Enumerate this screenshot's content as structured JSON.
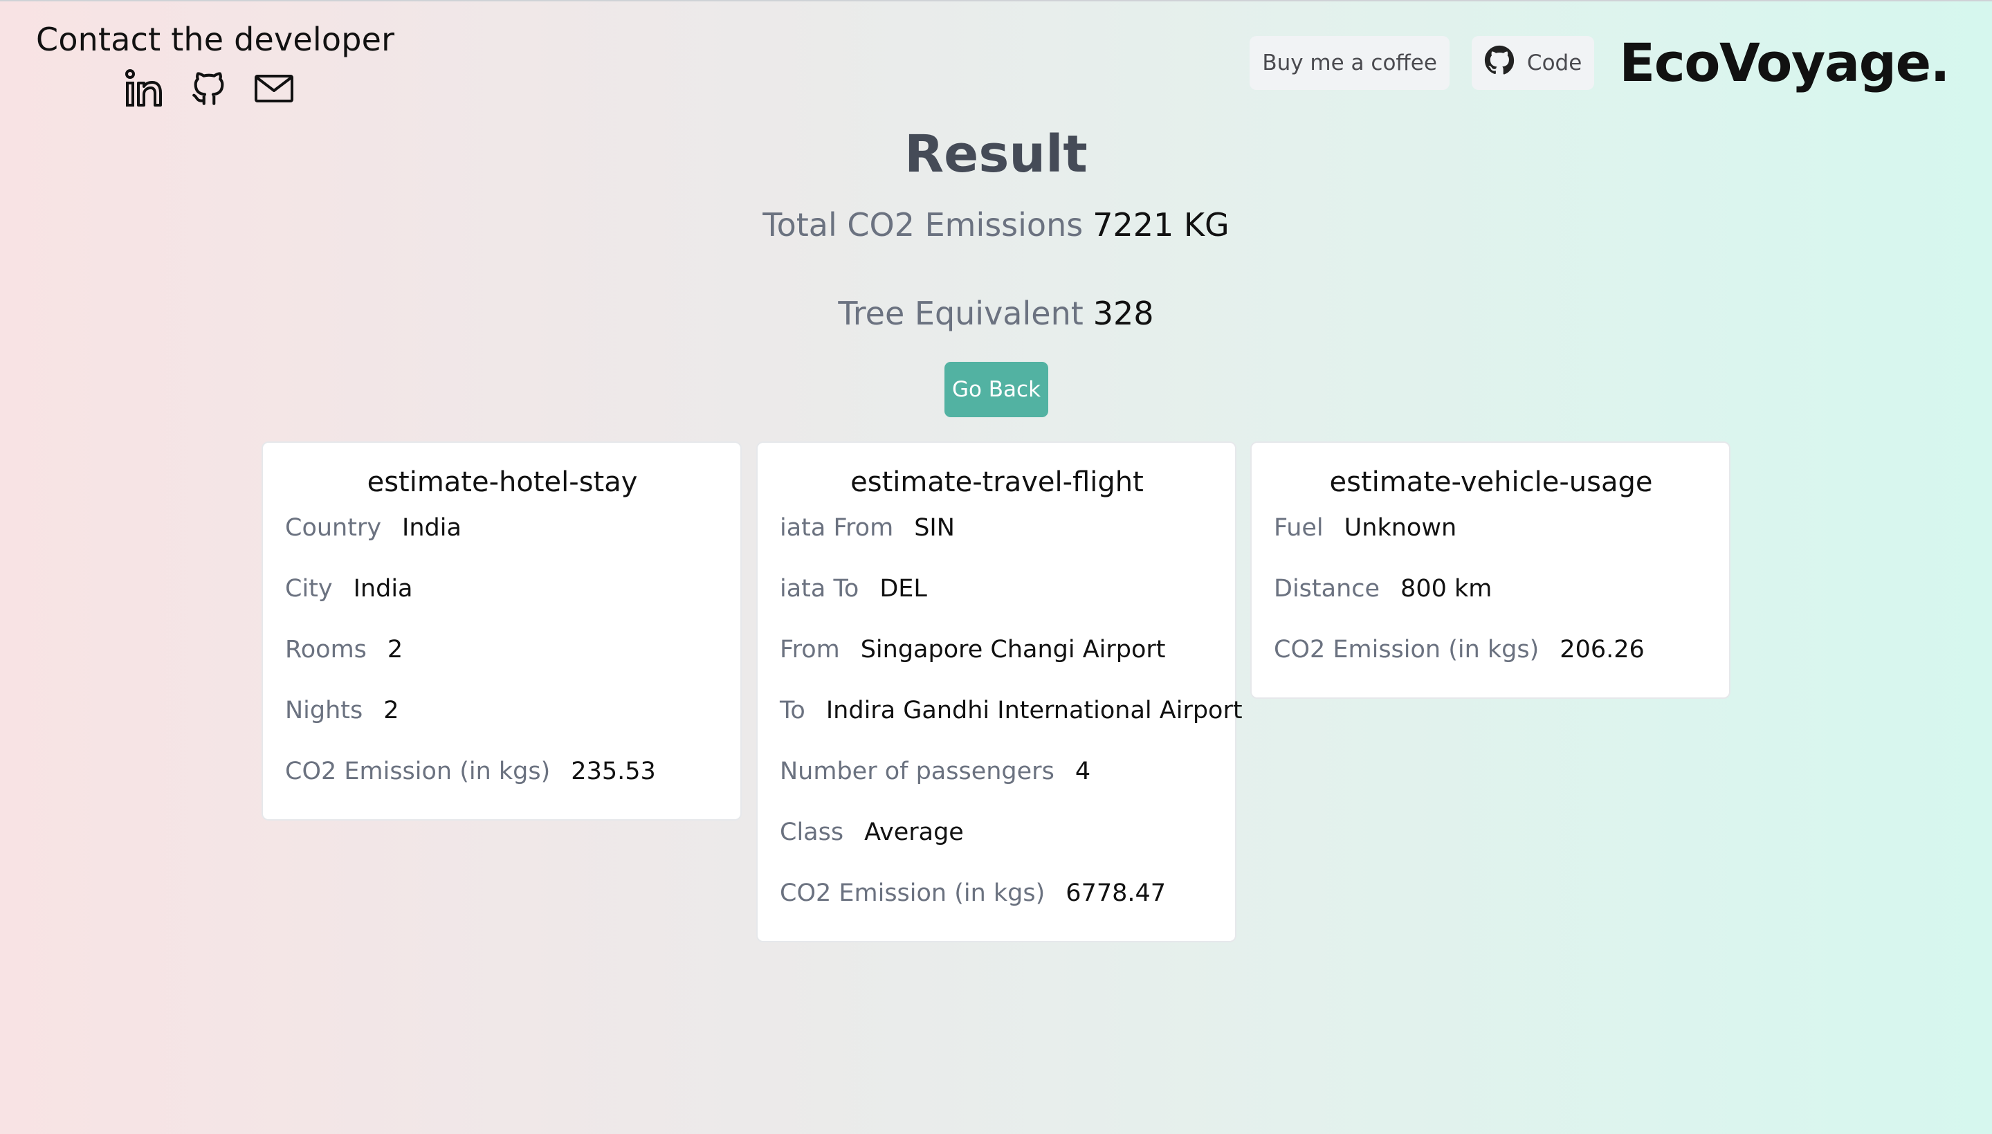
{
  "contact": {
    "title": "Contact the developer",
    "icons": [
      "linkedin-icon",
      "github-icon",
      "mail-icon"
    ]
  },
  "header": {
    "buy_coffee_label": "Buy me a coffee",
    "code_label": "Code",
    "brand": "EcoVoyage."
  },
  "result": {
    "title": "Result",
    "total_label": "Total CO2 Emissions",
    "total_value": "7221 KG",
    "tree_label": "Tree Equivalent",
    "tree_value": "328",
    "go_back_label": "Go Back"
  },
  "cards": [
    {
      "title": "estimate-hotel-stay",
      "rows": [
        {
          "k": "Country",
          "v": "India"
        },
        {
          "k": "City",
          "v": "India"
        },
        {
          "k": "Rooms",
          "v": "2"
        },
        {
          "k": "Nights",
          "v": "2"
        },
        {
          "k": "CO2 Emission (in kgs)",
          "v": "235.53"
        }
      ]
    },
    {
      "title": "estimate-travel-flight",
      "rows": [
        {
          "k": "iata From",
          "v": "SIN"
        },
        {
          "k": "iata To",
          "v": "DEL"
        },
        {
          "k": "From",
          "v": "Singapore Changi Airport"
        },
        {
          "k": "To",
          "v": "Indira Gandhi International Airport"
        },
        {
          "k": "Number of passengers",
          "v": "4"
        },
        {
          "k": "Class",
          "v": "Average"
        },
        {
          "k": "CO2 Emission (in kgs)",
          "v": "6778.47"
        }
      ]
    },
    {
      "title": "estimate-vehicle-usage",
      "rows": [
        {
          "k": "Fuel",
          "v": "Unknown"
        },
        {
          "k": "Distance",
          "v": "800 km"
        },
        {
          "k": "CO2 Emission (in kgs)",
          "v": "206.26"
        }
      ]
    }
  ],
  "colors": {
    "accent": "#52b2a2",
    "muted_text": "#6b7280",
    "heading": "#454b57"
  }
}
